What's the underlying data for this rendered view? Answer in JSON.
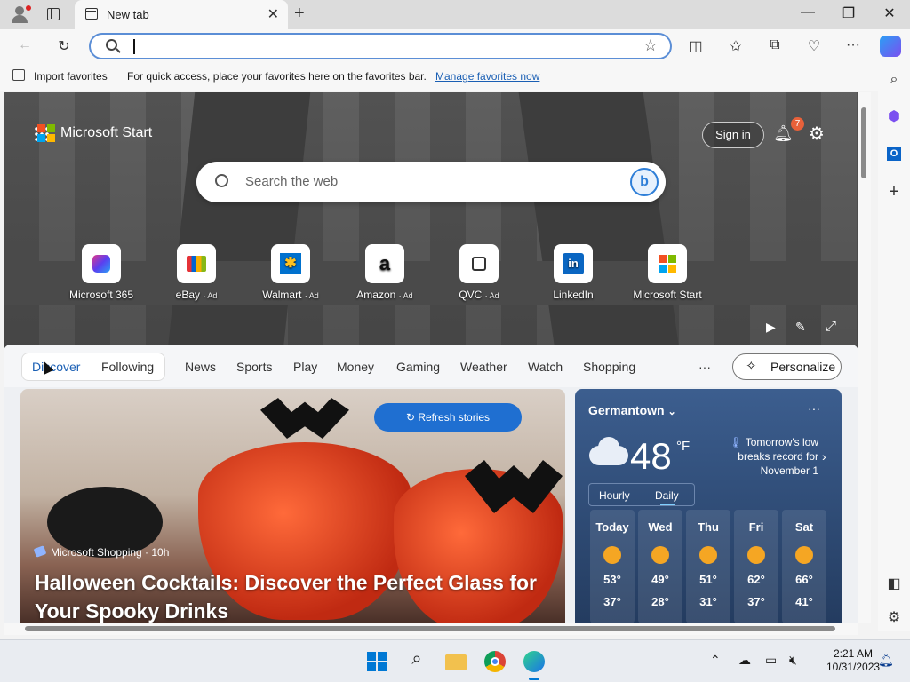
{
  "browser": {
    "tab_title": "New tab",
    "address_value": "",
    "favorites_bar": {
      "import_label": "Import favorites",
      "hint": "For quick access, place your favorites here on the favorites bar.",
      "manage_link": "Manage favorites now"
    }
  },
  "start": {
    "brand": "Microsoft Start",
    "sign_in": "Sign in",
    "notification_count": "7",
    "search_placeholder": "Search the web",
    "quick_links": [
      {
        "label": "Microsoft 365",
        "ad": ""
      },
      {
        "label": "eBay",
        "ad": "· Ad"
      },
      {
        "label": "Walmart",
        "ad": "· Ad"
      },
      {
        "label": "Amazon",
        "ad": "· Ad"
      },
      {
        "label": "QVC",
        "ad": "· Ad"
      },
      {
        "label": "LinkedIn",
        "ad": ""
      },
      {
        "label": "Microsoft Start",
        "ad": ""
      }
    ],
    "nav": [
      "Discover",
      "Following",
      "News",
      "Sports",
      "Play",
      "Money",
      "Gaming",
      "Weather",
      "Watch",
      "Shopping"
    ],
    "more": "···",
    "personalize": "Personalize",
    "story": {
      "refresh": "Refresh stories",
      "source": "Microsoft Shopping · 10h",
      "title": "Halloween Cocktails: Discover the Perfect Glass for Your Spooky Drinks"
    },
    "weather": {
      "location": "Germantown",
      "temp": "48",
      "unit": "°F",
      "alert": "Tomorrow's low breaks record for November 1",
      "tabs": [
        "Hourly",
        "Daily"
      ],
      "days": [
        {
          "day": "Today",
          "hi": "53°",
          "lo": "37°"
        },
        {
          "day": "Wed",
          "hi": "49°",
          "lo": "28°"
        },
        {
          "day": "Thu",
          "hi": "51°",
          "lo": "31°"
        },
        {
          "day": "Fri",
          "hi": "62°",
          "lo": "37°"
        },
        {
          "day": "Sat",
          "hi": "66°",
          "lo": "41°"
        }
      ]
    }
  },
  "taskbar": {
    "time": "2:21 AM",
    "date": "10/31/2023"
  },
  "colors": {
    "accent": "#1f6fd1",
    "address_border": "#5b8ed6",
    "badge": "#e8613a"
  }
}
